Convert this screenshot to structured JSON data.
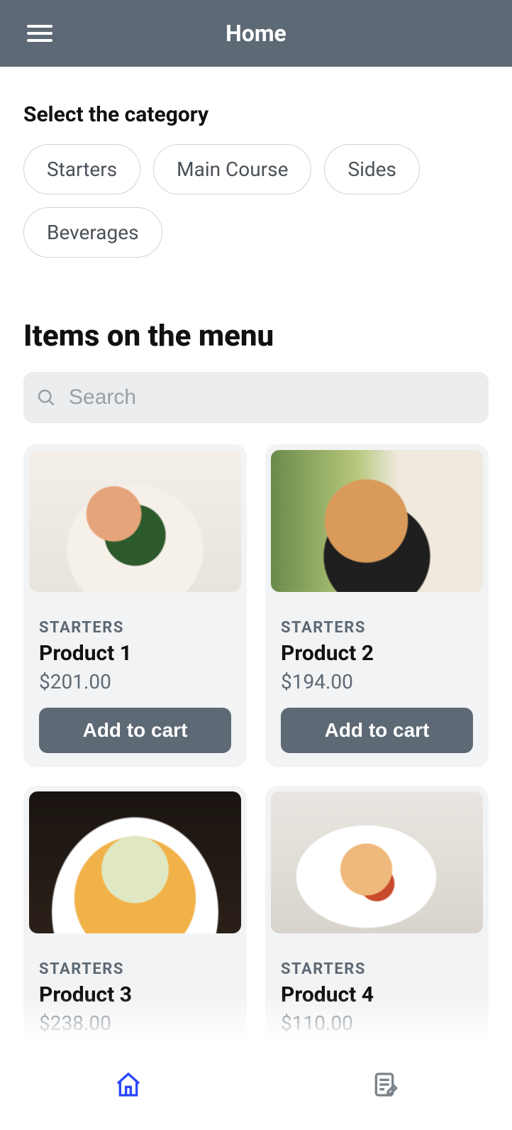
{
  "header": {
    "title": "Home"
  },
  "category": {
    "label": "Select the category",
    "chips": [
      "Starters",
      "Main Course",
      "Sides",
      "Beverages"
    ]
  },
  "items": {
    "heading": "Items on the menu",
    "search_placeholder": "Search",
    "add_label": "Add to cart",
    "products": [
      {
        "category": "STARTERS",
        "name": "Product 1",
        "price": "$201.00"
      },
      {
        "category": "STARTERS",
        "name": "Product 2",
        "price": "$194.00"
      },
      {
        "category": "STARTERS",
        "name": "Product 3",
        "price": "$238.00"
      },
      {
        "category": "STARTERS",
        "name": "Product 4",
        "price": "$110.00"
      }
    ]
  }
}
